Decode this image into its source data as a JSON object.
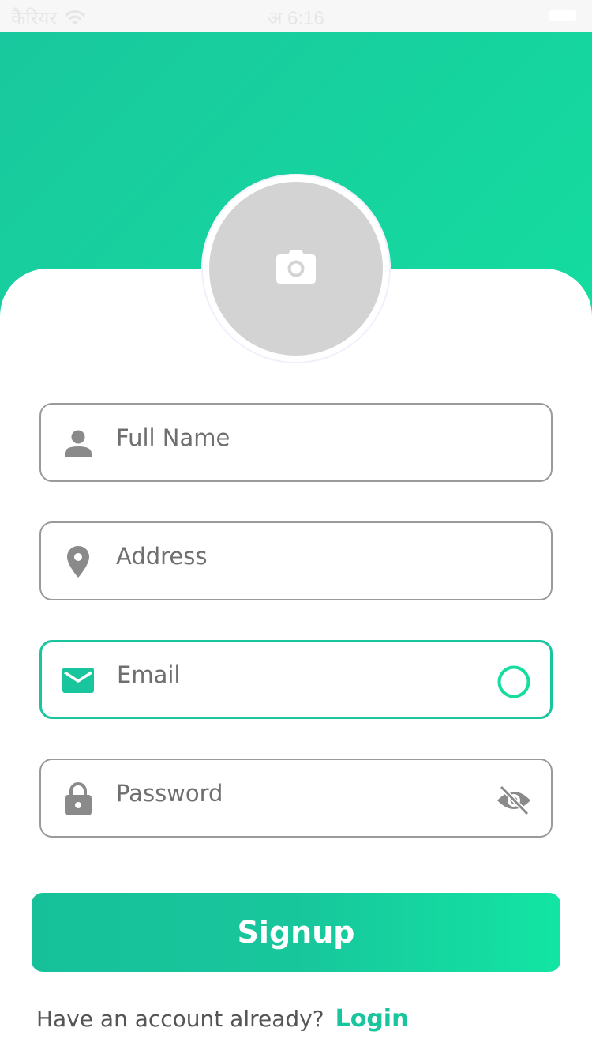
{
  "status_bar": {
    "carrier": "कैरियर",
    "time": "अ 6:16"
  },
  "avatar": {
    "icon": "camera-icon"
  },
  "form": {
    "full_name": {
      "placeholder": "Full Name",
      "value": "",
      "icon": "person-icon"
    },
    "address": {
      "placeholder": "Address",
      "value": "",
      "icon": "location-pin-icon"
    },
    "email": {
      "placeholder": "Email",
      "value": "",
      "icon": "mail-icon",
      "trailing_icon": "status-circle-icon"
    },
    "password": {
      "placeholder": "Password",
      "value": "",
      "icon": "lock-icon",
      "trailing_icon": "eye-off-icon"
    }
  },
  "signup_button": {
    "label": "Signup"
  },
  "footer": {
    "prompt": "Have an account already?",
    "login_label": "Login"
  },
  "colors": {
    "accent": "#18c59d",
    "header_gradient_start": "#19c89e",
    "header_gradient_end": "#14dd9f",
    "field_border": "#9a9a9a",
    "icon_gray": "#8a8a8a",
    "avatar_placeholder": "#d3d3d3"
  }
}
